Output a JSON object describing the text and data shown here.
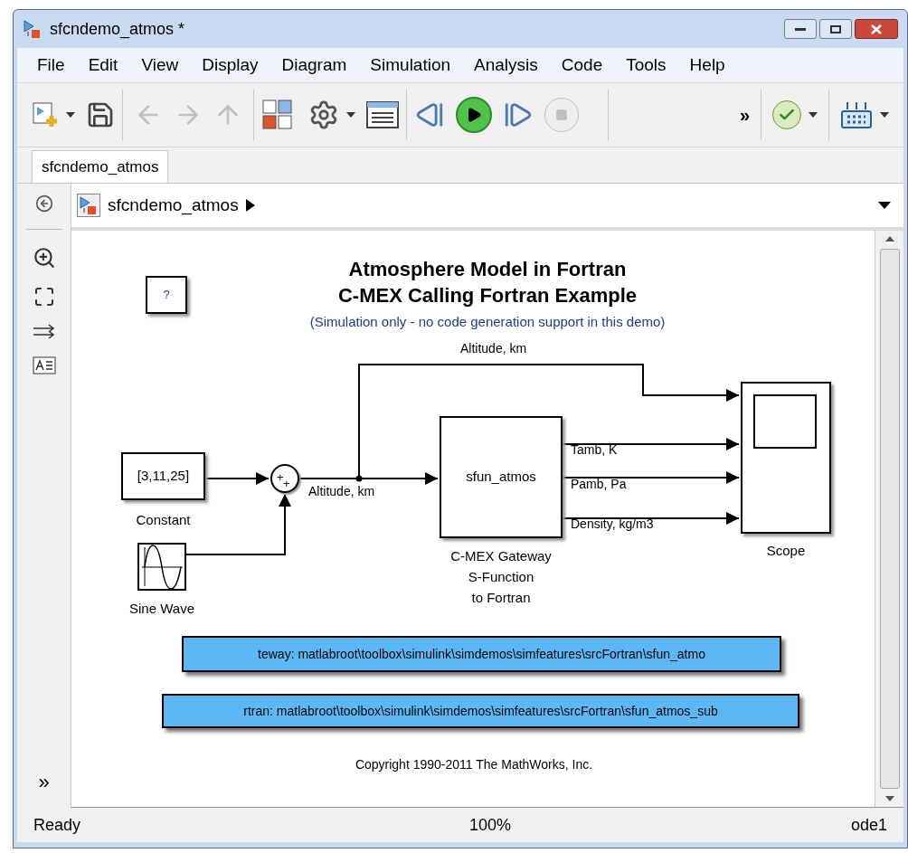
{
  "window": {
    "title": "sfcndemo_atmos *"
  },
  "menu": [
    "File",
    "Edit",
    "View",
    "Display",
    "Diagram",
    "Simulation",
    "Analysis",
    "Code",
    "Tools",
    "Help"
  ],
  "toolbar": {
    "overflow": "»"
  },
  "tabs": [
    {
      "label": "sfcndemo_atmos",
      "selected": true
    }
  ],
  "breadcrumb": {
    "path": "sfcndemo_atmos"
  },
  "palette": {
    "expand": "»"
  },
  "diagram": {
    "title": [
      "Atmosphere Model in Fortran",
      "C-MEX Calling Fortran Example"
    ],
    "subtitle": "(Simulation only - no code generation support in this demo)",
    "help_block": "?",
    "blocks": [
      {
        "kind": "constant",
        "value": "[3,11,25]",
        "label": [
          "Constant"
        ]
      },
      {
        "kind": "sum",
        "signs": [
          "+",
          "+"
        ]
      },
      {
        "kind": "sine",
        "label": [
          "Sine Wave"
        ]
      },
      {
        "kind": "sfunction",
        "value": "sfun_atmos",
        "label": [
          "C-MEX Gateway",
          "S-Function",
          "to Fortran"
        ]
      },
      {
        "kind": "scope",
        "label": [
          "Scope"
        ]
      }
    ],
    "signal_labels": [
      "Altitude, km",
      "Altitude, km",
      "Tamb, K",
      "Pamb, Pa",
      "Density, kg/m3"
    ],
    "links": [
      "teway: matlabroot\\toolbox\\simulink\\simdemos\\simfeatures\\srcFortran\\sfun_atmo",
      "rtran: matlabroot\\toolbox\\simulink\\simdemos\\simfeatures\\srcFortran\\sfun_atmos_sub"
    ],
    "copyright": "Copyright 1990-2011 The MathWorks, Inc."
  },
  "status_bar": {
    "state": "Ready",
    "zoom": "100%",
    "solver": "ode1"
  }
}
